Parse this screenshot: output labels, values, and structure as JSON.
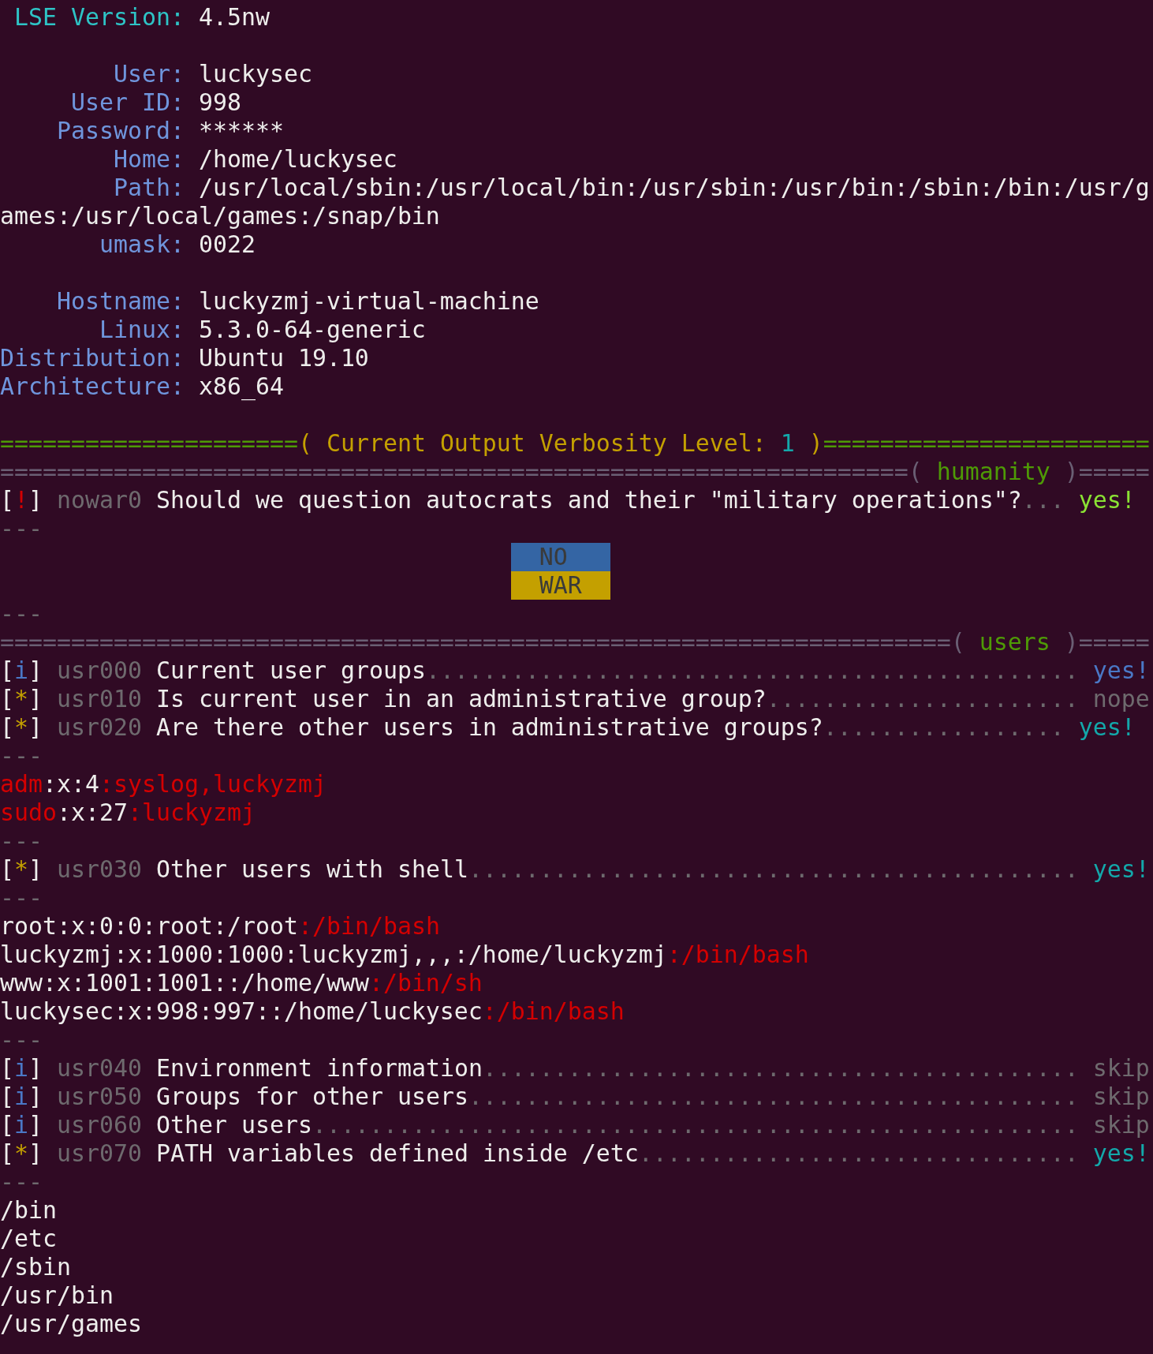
{
  "terminal": {
    "lines": [
      {
        "kind": "title",
        "key": "LSE Version:",
        "value": "4.5nw"
      },
      {
        "kind": "blank"
      },
      {
        "kind": "field",
        "key": "User:",
        "value": "luckysec"
      },
      {
        "kind": "field",
        "key": "User ID:",
        "value": "998"
      },
      {
        "kind": "field",
        "key": "Password:",
        "value": "******"
      },
      {
        "kind": "field",
        "key": "Home:",
        "value": "/home/luckysec"
      },
      {
        "kind": "field",
        "key": "Path:",
        "value": "/usr/local/sbin:/usr/local/bin:/usr/sbin:/usr/bin:/sbin:/bin:/usr/g"
      },
      {
        "kind": "text",
        "segments": [
          {
            "text": "ames:/usr/local/games:/snap/bin",
            "color": "#eeeeec"
          }
        ]
      },
      {
        "kind": "field",
        "key": "umask:",
        "value": "0022"
      },
      {
        "kind": "blank"
      },
      {
        "kind": "field",
        "key": "Hostname:",
        "value": "luckyzmj-virtual-machine"
      },
      {
        "kind": "field",
        "key": "Linux:",
        "value": "5.3.0-64-generic"
      },
      {
        "kind": "field",
        "key": "Distribution:",
        "value": "Ubuntu 19.10"
      },
      {
        "kind": "field",
        "key": "Architecture:",
        "value": "x86_64"
      },
      {
        "kind": "blank"
      },
      {
        "kind": "text",
        "segments": [
          {
            "text": "=====================",
            "color": "#4e9a06"
          },
          {
            "text": "( Current Output Verbosity Level: ",
            "color": "#c4a000"
          },
          {
            "text": "1",
            "color": "#13a8aa"
          },
          {
            "text": " )",
            "color": "#c4a000"
          },
          {
            "text": "=======================",
            "color": "#4e9a06"
          }
        ]
      },
      {
        "kind": "text",
        "segments": [
          {
            "text": "================================================================( ",
            "color": "#6a5f74"
          },
          {
            "text": "humanity",
            "color": "#4e9a06"
          },
          {
            "text": " )=====",
            "color": "#6a5f74"
          }
        ]
      },
      {
        "kind": "text",
        "segments": [
          {
            "text": "[",
            "color": "#eeeeec"
          },
          {
            "text": "!",
            "color": "#d40000"
          },
          {
            "text": "]",
            "color": "#eeeeec"
          },
          {
            "text": " nowar0",
            "color": "#6e6a6e"
          },
          {
            "text": " Should we question autocrats and their \"military operations\"?",
            "color": "#eeeeec"
          },
          {
            "text": "...",
            "color": "#6e6a6e"
          },
          {
            "text": " yes!",
            "color": "#8ae234"
          }
        ]
      },
      {
        "kind": "text",
        "segments": [
          {
            "text": "---",
            "color": "#6e6a6e"
          }
        ]
      },
      {
        "kind": "flag",
        "text": "NO",
        "color": "#3465a4"
      },
      {
        "kind": "flag",
        "text": "WAR",
        "color": "#c4a000"
      },
      {
        "kind": "text",
        "segments": [
          {
            "text": "---",
            "color": "#6e6a6e"
          }
        ]
      },
      {
        "kind": "text",
        "segments": [
          {
            "text": "===================================================================( ",
            "color": "#6a5f74"
          },
          {
            "text": "users",
            "color": "#4e9a06"
          },
          {
            "text": " )=====",
            "color": "#6a5f74"
          }
        ]
      },
      {
        "kind": "text",
        "segments": [
          {
            "text": "[",
            "color": "#eeeeec"
          },
          {
            "text": "i",
            "color": "#4a78c6"
          },
          {
            "text": "]",
            "color": "#eeeeec"
          },
          {
            "text": " usr000",
            "color": "#6e6a6e"
          },
          {
            "text": " Current user groups",
            "color": "#eeeeec"
          },
          {
            "text": "..............................................",
            "color": "#6e6a6e"
          },
          {
            "text": " yes!",
            "color": "#4a78c6"
          }
        ]
      },
      {
        "kind": "text",
        "segments": [
          {
            "text": "[",
            "color": "#eeeeec"
          },
          {
            "text": "*",
            "color": "#c4a000"
          },
          {
            "text": "]",
            "color": "#eeeeec"
          },
          {
            "text": " usr010",
            "color": "#6e6a6e"
          },
          {
            "text": " Is current user in an administrative group?",
            "color": "#eeeeec"
          },
          {
            "text": "......................",
            "color": "#6e6a6e"
          },
          {
            "text": " nope",
            "color": "#6e6a6e"
          }
        ]
      },
      {
        "kind": "text",
        "segments": [
          {
            "text": "[",
            "color": "#eeeeec"
          },
          {
            "text": "*",
            "color": "#c4a000"
          },
          {
            "text": "]",
            "color": "#eeeeec"
          },
          {
            "text": " usr020",
            "color": "#6e6a6e"
          },
          {
            "text": " Are there other users in administrative groups?",
            "color": "#eeeeec"
          },
          {
            "text": ".................",
            "color": "#6e6a6e"
          },
          {
            "text": " yes!",
            "color": "#13a8aa"
          }
        ]
      },
      {
        "kind": "text",
        "segments": [
          {
            "text": "---",
            "color": "#6e6a6e"
          }
        ]
      },
      {
        "kind": "text",
        "segments": [
          {
            "text": "adm",
            "color": "#d40000"
          },
          {
            "text": ":x:4",
            "color": "#eeeeec"
          },
          {
            "text": ":syslog,luckyzmj",
            "color": "#d40000"
          }
        ]
      },
      {
        "kind": "text",
        "segments": [
          {
            "text": "sudo",
            "color": "#d40000"
          },
          {
            "text": ":x:27",
            "color": "#eeeeec"
          },
          {
            "text": ":luckyzmj",
            "color": "#d40000"
          }
        ]
      },
      {
        "kind": "text",
        "segments": [
          {
            "text": "---",
            "color": "#6e6a6e"
          }
        ]
      },
      {
        "kind": "text",
        "segments": [
          {
            "text": "[",
            "color": "#eeeeec"
          },
          {
            "text": "*",
            "color": "#c4a000"
          },
          {
            "text": "]",
            "color": "#eeeeec"
          },
          {
            "text": " usr030",
            "color": "#6e6a6e"
          },
          {
            "text": " Other users with shell",
            "color": "#eeeeec"
          },
          {
            "text": "...........................................",
            "color": "#6e6a6e"
          },
          {
            "text": " yes!",
            "color": "#13a8aa"
          }
        ]
      },
      {
        "kind": "text",
        "segments": [
          {
            "text": "---",
            "color": "#6e6a6e"
          }
        ]
      },
      {
        "kind": "text",
        "segments": [
          {
            "text": "root:x:0:0:root:/root",
            "color": "#eeeeec"
          },
          {
            "text": ":/bin/bash",
            "color": "#d40000"
          }
        ]
      },
      {
        "kind": "text",
        "segments": [
          {
            "text": "luckyzmj:x:1000:1000:luckyzmj,,,:/home/luckyzmj",
            "color": "#eeeeec"
          },
          {
            "text": ":/bin/bash",
            "color": "#d40000"
          }
        ]
      },
      {
        "kind": "text",
        "segments": [
          {
            "text": "www:x:1001:1001::/home/www",
            "color": "#eeeeec"
          },
          {
            "text": ":/bin/sh",
            "color": "#d40000"
          }
        ]
      },
      {
        "kind": "text",
        "segments": [
          {
            "text": "luckysec:x:998:997::/home/luckysec",
            "color": "#eeeeec"
          },
          {
            "text": ":/bin/bash",
            "color": "#d40000"
          }
        ]
      },
      {
        "kind": "text",
        "segments": [
          {
            "text": "---",
            "color": "#6e6a6e"
          }
        ]
      },
      {
        "kind": "text",
        "segments": [
          {
            "text": "[",
            "color": "#eeeeec"
          },
          {
            "text": "i",
            "color": "#4a78c6"
          },
          {
            "text": "]",
            "color": "#eeeeec"
          },
          {
            "text": " usr040",
            "color": "#6e6a6e"
          },
          {
            "text": " Environment information",
            "color": "#eeeeec"
          },
          {
            "text": "..........................................",
            "color": "#6e6a6e"
          },
          {
            "text": " skip",
            "color": "#6e6a6e"
          }
        ]
      },
      {
        "kind": "text",
        "segments": [
          {
            "text": "[",
            "color": "#eeeeec"
          },
          {
            "text": "i",
            "color": "#4a78c6"
          },
          {
            "text": "]",
            "color": "#eeeeec"
          },
          {
            "text": " usr050",
            "color": "#6e6a6e"
          },
          {
            "text": " Groups for other users",
            "color": "#eeeeec"
          },
          {
            "text": "...........................................",
            "color": "#6e6a6e"
          },
          {
            "text": " skip",
            "color": "#6e6a6e"
          }
        ]
      },
      {
        "kind": "text",
        "segments": [
          {
            "text": "[",
            "color": "#eeeeec"
          },
          {
            "text": "i",
            "color": "#4a78c6"
          },
          {
            "text": "]",
            "color": "#eeeeec"
          },
          {
            "text": " usr060",
            "color": "#6e6a6e"
          },
          {
            "text": " Other users",
            "color": "#eeeeec"
          },
          {
            "text": "......................................................",
            "color": "#6e6a6e"
          },
          {
            "text": " skip",
            "color": "#6e6a6e"
          }
        ]
      },
      {
        "kind": "text",
        "segments": [
          {
            "text": "[",
            "color": "#eeeeec"
          },
          {
            "text": "*",
            "color": "#c4a000"
          },
          {
            "text": "]",
            "color": "#eeeeec"
          },
          {
            "text": " usr070",
            "color": "#6e6a6e"
          },
          {
            "text": " PATH variables defined inside /etc",
            "color": "#eeeeec"
          },
          {
            "text": "...............................",
            "color": "#6e6a6e"
          },
          {
            "text": " yes!",
            "color": "#13a8aa"
          }
        ]
      },
      {
        "kind": "text",
        "segments": [
          {
            "text": "---",
            "color": "#6e6a6e"
          }
        ]
      },
      {
        "kind": "text",
        "segments": [
          {
            "text": "/bin",
            "color": "#eeeeec"
          }
        ]
      },
      {
        "kind": "text",
        "segments": [
          {
            "text": "/etc",
            "color": "#eeeeec"
          }
        ]
      },
      {
        "kind": "text",
        "segments": [
          {
            "text": "/sbin",
            "color": "#eeeeec"
          }
        ]
      },
      {
        "kind": "text",
        "segments": [
          {
            "text": "/usr/bin",
            "color": "#eeeeec"
          }
        ]
      },
      {
        "kind": "text",
        "segments": [
          {
            "text": "/usr/games",
            "color": "#eeeeec"
          }
        ]
      }
    ]
  }
}
